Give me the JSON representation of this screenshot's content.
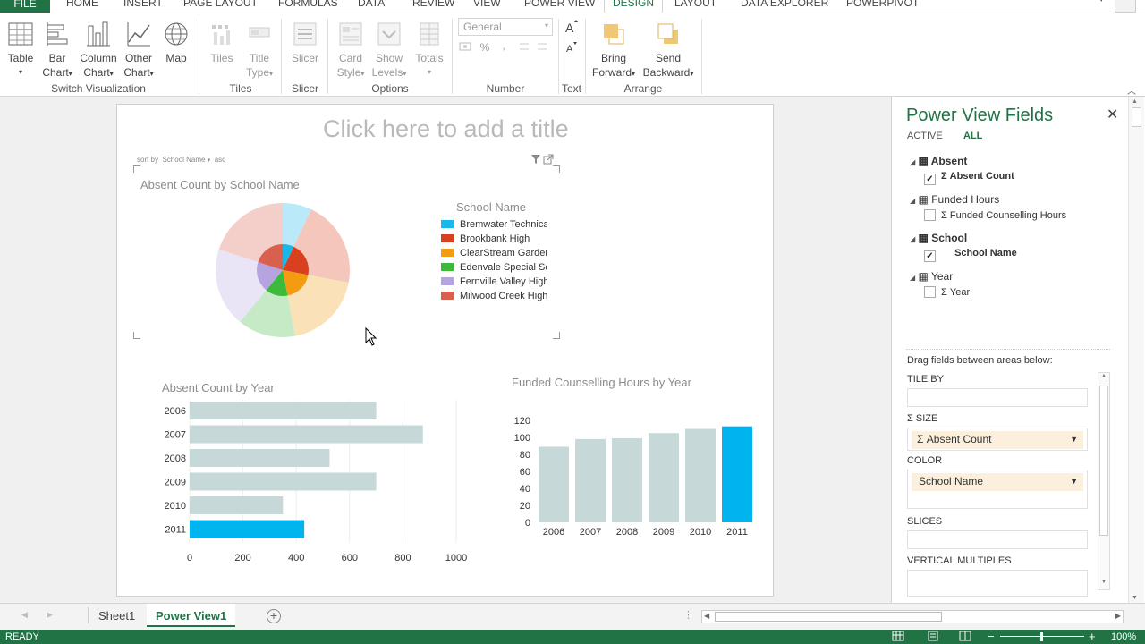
{
  "ribbon_tabs": [
    "FILE",
    "HOME",
    "INSERT",
    "PAGE LAYOUT",
    "FORMULAS",
    "DATA",
    "REVIEW",
    "VIEW",
    "POWER VIEW",
    "DESIGN",
    "LAYOUT",
    "DATA EXPLORER",
    "POWERPIVOT"
  ],
  "ribbon": {
    "switch": {
      "table": "Table",
      "bar": "Bar",
      "bar2": "Chart",
      "column": "Column",
      "column2": "Chart",
      "other": "Other",
      "other2": "Chart",
      "map": "Map",
      "group": "Switch Visualization"
    },
    "tiles": {
      "tiles": "Tiles",
      "title": "Title",
      "title2": "Type",
      "group": "Tiles"
    },
    "slicer": {
      "slicer": "Slicer",
      "group": "Slicer"
    },
    "options": {
      "card": "Card",
      "card2": "Style",
      "show": "Show",
      "show2": "Levels",
      "totals": "Totals",
      "group": "Options"
    },
    "number": {
      "format": "General",
      "pct": "%",
      "comma": ",",
      "group": "Number"
    },
    "text": {
      "group": "Text"
    },
    "arrange": {
      "bring": "Bring",
      "bring2": "Forward",
      "send": "Send",
      "send2": "Backward",
      "group": "Arrange"
    }
  },
  "canvas": {
    "title_placeholder": "Click here to add a title",
    "sort": {
      "by": "sort by",
      "field": "School Name",
      "order": "asc"
    },
    "pie_title": "Absent Count by School Name",
    "legend_title": "School Name",
    "legend": [
      {
        "name": "Bremwater Technical",
        "color": "#1ab7ea"
      },
      {
        "name": "Brookbank High",
        "color": "#d9401f"
      },
      {
        "name": "ClearStream Gardens",
        "color": "#f39c12"
      },
      {
        "name": "Edenvale Special School",
        "color": "#3cba3c"
      },
      {
        "name": "Fernville Valley High",
        "color": "#b5a4e0"
      },
      {
        "name": "Milwood Creek High",
        "color": "#d9604f"
      }
    ],
    "bar_title": "Absent Count by Year",
    "col_title": "Funded Counselling Hours by Year"
  },
  "chart_data": [
    {
      "type": "pie",
      "title": "Absent Count by School Name",
      "legend_title": "School Name",
      "categories": [
        "Bremwater Technical",
        "Brookbank High",
        "ClearStream Gardens",
        "Edenvale Special School",
        "Fernville Valley High",
        "Milwood Creek High"
      ],
      "values": [
        7,
        21,
        19,
        14,
        19,
        20
      ],
      "colors": [
        "#1ab7ea",
        "#d9401f",
        "#f39c12",
        "#3cba3c",
        "#b5a4e0",
        "#d9604f"
      ]
    },
    {
      "type": "bar",
      "title": "Absent Count by Year",
      "categories": [
        "2006",
        "2007",
        "2008",
        "2009",
        "2010",
        "2011"
      ],
      "values": [
        700,
        875,
        525,
        700,
        350,
        430
      ],
      "xlim": [
        0,
        1000
      ],
      "ticks": [
        "0",
        "200",
        "400",
        "600",
        "800",
        "1000"
      ],
      "highlight": "2011",
      "grid": true
    },
    {
      "type": "bar",
      "title": "Funded Counselling Hours by Year",
      "categories": [
        "2006",
        "2007",
        "2008",
        "2009",
        "2010",
        "2011"
      ],
      "values": [
        89,
        98,
        99,
        105,
        110,
        113
      ],
      "ylim": [
        0,
        120
      ],
      "ticks": [
        "0",
        "20",
        "40",
        "60",
        "80",
        "100",
        "120"
      ],
      "highlight": "2011"
    }
  ],
  "panel": {
    "title": "Power View Fields",
    "tab_active": "ACTIVE",
    "tab_all": "ALL",
    "tables": [
      {
        "name": "Absent",
        "field": "Absent Count",
        "checked": "✓"
      },
      {
        "name": "Funded Hours",
        "field": "Funded Counselling Hours",
        "checked": ""
      },
      {
        "name": "School",
        "field": "School Name",
        "checked": "✓"
      },
      {
        "name": "Year",
        "field": "Year",
        "checked": ""
      }
    ],
    "drag_text": "Drag fields between areas below:",
    "tile_by": "TILE BY",
    "size": "SIZE",
    "size_field": "Absent Count",
    "color": "COLOR",
    "color_field": "School Name",
    "slices": "SLICES",
    "vertical": "VERTICAL MULTIPLES"
  },
  "sheets": {
    "tab1": "Sheet1",
    "tab2": "Power View1"
  },
  "status": {
    "ready": "READY",
    "zoom": "100%"
  },
  "colors": {
    "accent": "#217346",
    "highlight": "#00b4f0",
    "muted_bar": "#c7d8d8"
  }
}
